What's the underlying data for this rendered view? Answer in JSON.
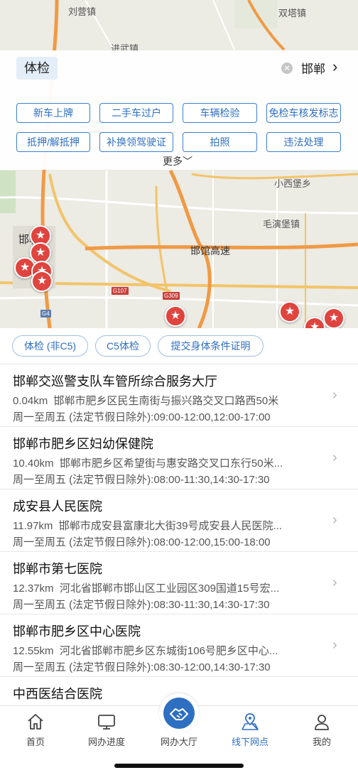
{
  "map": {
    "labels": {
      "liuying": "刘营镇",
      "shuangta": "双塔镇",
      "jinwu": "进武镇",
      "xiaoxibao": "小西堡乡",
      "maoyanbao": "毛演堡镇",
      "handan_city": "邯郸市",
      "hanguan": "邯馆高速"
    },
    "shields": {
      "g107": "G107",
      "g309": "G309",
      "g4": "G4"
    },
    "pin_glyph": "★"
  },
  "search": {
    "keyword": "体检",
    "clear_glyph": "✕",
    "city": "邯郸",
    "chevron": "›"
  },
  "quick_links": [
    "新车上牌",
    "二手车过户",
    "车辆检验",
    "免检车核发标志",
    "抵押/解抵押",
    "补换领驾驶证",
    "拍照",
    "违法处理"
  ],
  "more_label": "更多﹀",
  "filters": [
    "体检 (非C5)",
    "C5体检",
    "提交身体条件证明"
  ],
  "list": [
    {
      "name": "邯郸交巡警支队车管所综合服务大厅",
      "distance": "0.04km",
      "address": "邯郸市肥乡区民生南街与振兴路交叉口路西50米",
      "hours": "周一至周五 (法定节假日除外):09:00-12:00,12:00-17:00"
    },
    {
      "name": "邯郸市肥乡区妇幼保健院",
      "distance": "10.40km",
      "address": "邯郸市肥乡区希望街与惠安路交叉口东行50米...",
      "hours": "周一至周五 (法定节假日除外):08:00-11:30,14:30-17:30"
    },
    {
      "name": "成安县人民医院",
      "distance": "11.97km",
      "address": "邯郸市成安县富康北大街39号成安县人民医院...",
      "hours": "周一至周五 (法定节假日除外):08:00-12:00,15:00-18:00"
    },
    {
      "name": "邯郸市第七医院",
      "distance": "12.37km",
      "address": "河北省邯郸市邯山区工业园区309国道15号宏...",
      "hours": "周一至周五 (法定节假日除外):08:30-11:30,14:30-17:30"
    },
    {
      "name": "邯郸市肥乡区中心医院",
      "distance": "12.55km",
      "address": "河北省邯郸市肥乡区东城街106号肥乡区中心...",
      "hours": "周一至周五 (法定节假日除外):08:30-12:00,14:30-17:30"
    },
    {
      "name": "中西医结合医院",
      "distance": "",
      "address": "",
      "hours": ""
    }
  ],
  "tabs": {
    "home": "首页",
    "progress": "网办进度",
    "hall": "网办大厅",
    "offline": "线下网点",
    "mine": "我的"
  },
  "colors": {
    "accent": "#2e6fc2",
    "pin": "#e0443e"
  }
}
